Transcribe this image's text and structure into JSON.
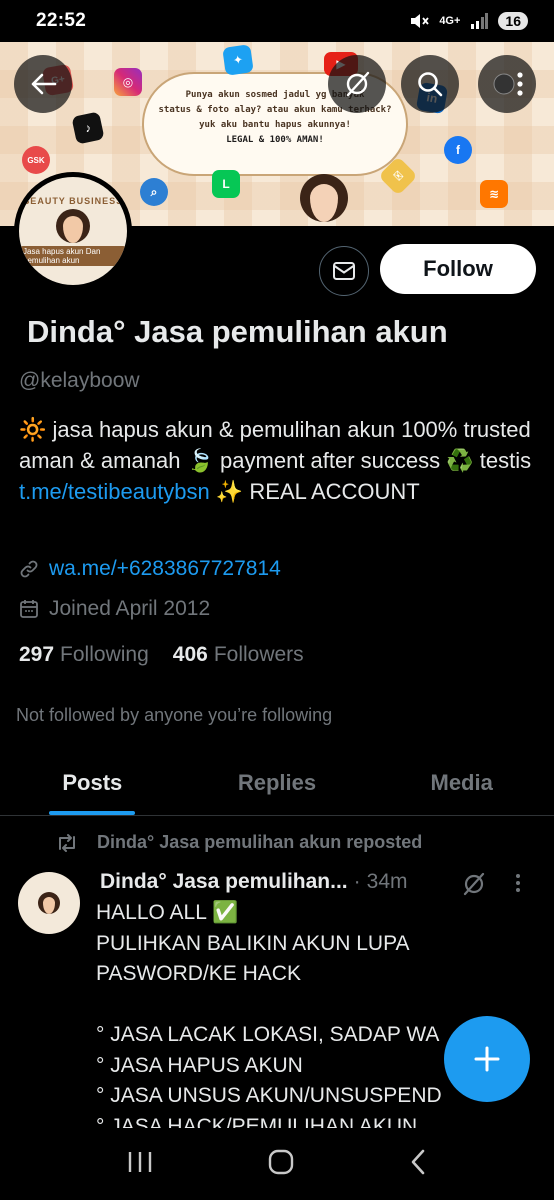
{
  "status_bar": {
    "time": "22:52",
    "network": "4G+",
    "battery": "16"
  },
  "banner": {
    "bubble_lines": [
      "Punya akun sosmed jadul yg banyak",
      "status & foto alay? atau akun kamu terhack?",
      "yuk aku bantu hapus akunnya!",
      "LEGAL & 100% AMAN!"
    ]
  },
  "avatar": {
    "line1": "BEAUTY BUSINESS",
    "line2": "Jasa hapus akun Dan pemulihan akun"
  },
  "profile": {
    "name": "Dinda° Jasa pemulihan akun",
    "handle": "@kelayboow",
    "bio_part1": "🔆 jasa hapus akun & pemulihan akun 100% trusted aman & amanah 🍃 payment after success ♻️ testis ",
    "bio_link": "t.me/testibeautybsn",
    "bio_part2": " ✨ REAL ACCOUNT",
    "website": "wa.me/+6283867727814",
    "joined": "Joined April 2012",
    "following_count": "297",
    "following_label": "Following",
    "followers_count": "406",
    "followers_label": "Followers",
    "not_followed": "Not followed by anyone you’re following"
  },
  "actions": {
    "follow_label": "Follow"
  },
  "tabs": [
    {
      "label": "Posts",
      "active": true
    },
    {
      "label": "Replies",
      "active": false
    },
    {
      "label": "Media",
      "active": false
    }
  ],
  "post": {
    "repost_label": "Dinda° Jasa pemulihan akun reposted",
    "author": "Dinda° Jasa pemulihan...",
    "separator": "·",
    "time": "34m",
    "text": "HALLO ALL ✅\nPULIHKAN BALIKIN AKUN LUPA PASWORD/KE HACK\n\n° JASA LACAK LOKASI, SADAP WA\n° JASA HAPUS AKUN\n° JASA UNSUS AKUN/UNSUSPEND\n° JASA HACK/PEMULIHAN AKUN"
  },
  "colors": {
    "accent": "#1d9bf0",
    "background": "#000000",
    "muted": "#71767b"
  }
}
